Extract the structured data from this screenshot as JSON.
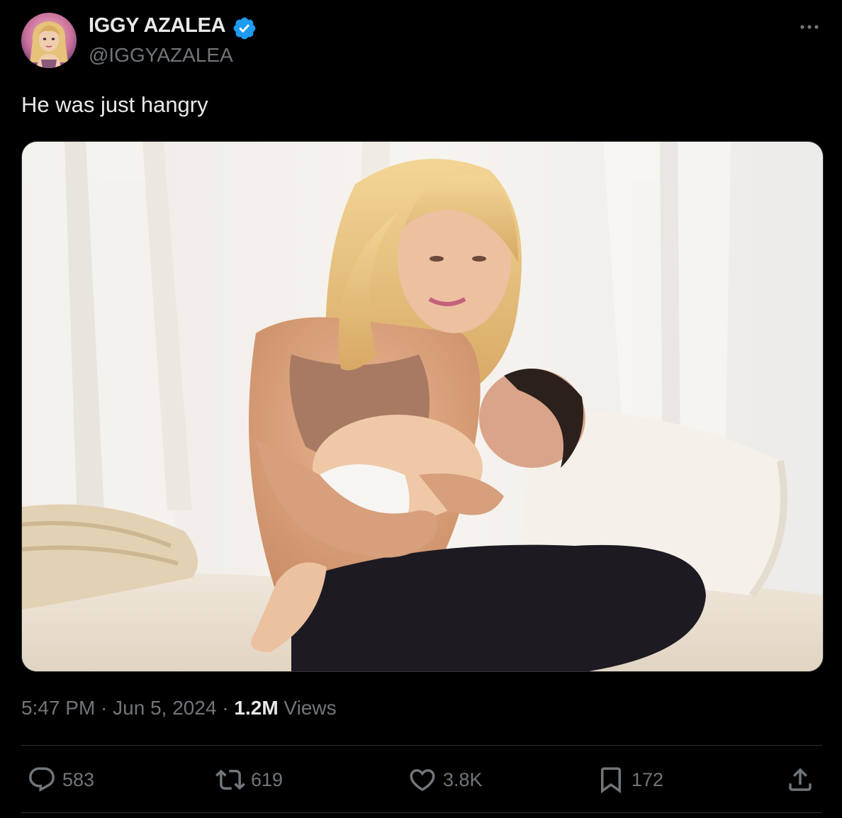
{
  "author": {
    "display_name": "IGGY AZALEA",
    "handle": "@IGGYAZALEA",
    "verified": true,
    "avatar_icon": "avatar-illustration"
  },
  "tweet": {
    "text": "He was just hangry",
    "media_description_icon": "photo",
    "time": "5:47 PM",
    "separator1": " · ",
    "date": "Jun 5, 2024",
    "separator2": " · ",
    "views_count": "1.2M",
    "views_label": " Views"
  },
  "actions": {
    "reply": {
      "icon": "reply-icon",
      "count": "583"
    },
    "retweet": {
      "icon": "retweet-icon",
      "count": "619"
    },
    "like": {
      "icon": "heart-icon",
      "count": "3.8K"
    },
    "bookmark": {
      "icon": "bookmark-icon",
      "count": "172"
    },
    "share": {
      "icon": "share-icon"
    }
  },
  "colors": {
    "background": "#000000",
    "primary_text": "#e7e9ea",
    "secondary_text": "#71767b",
    "verified_badge": "#1d9bf0",
    "divider": "#2f3336"
  }
}
